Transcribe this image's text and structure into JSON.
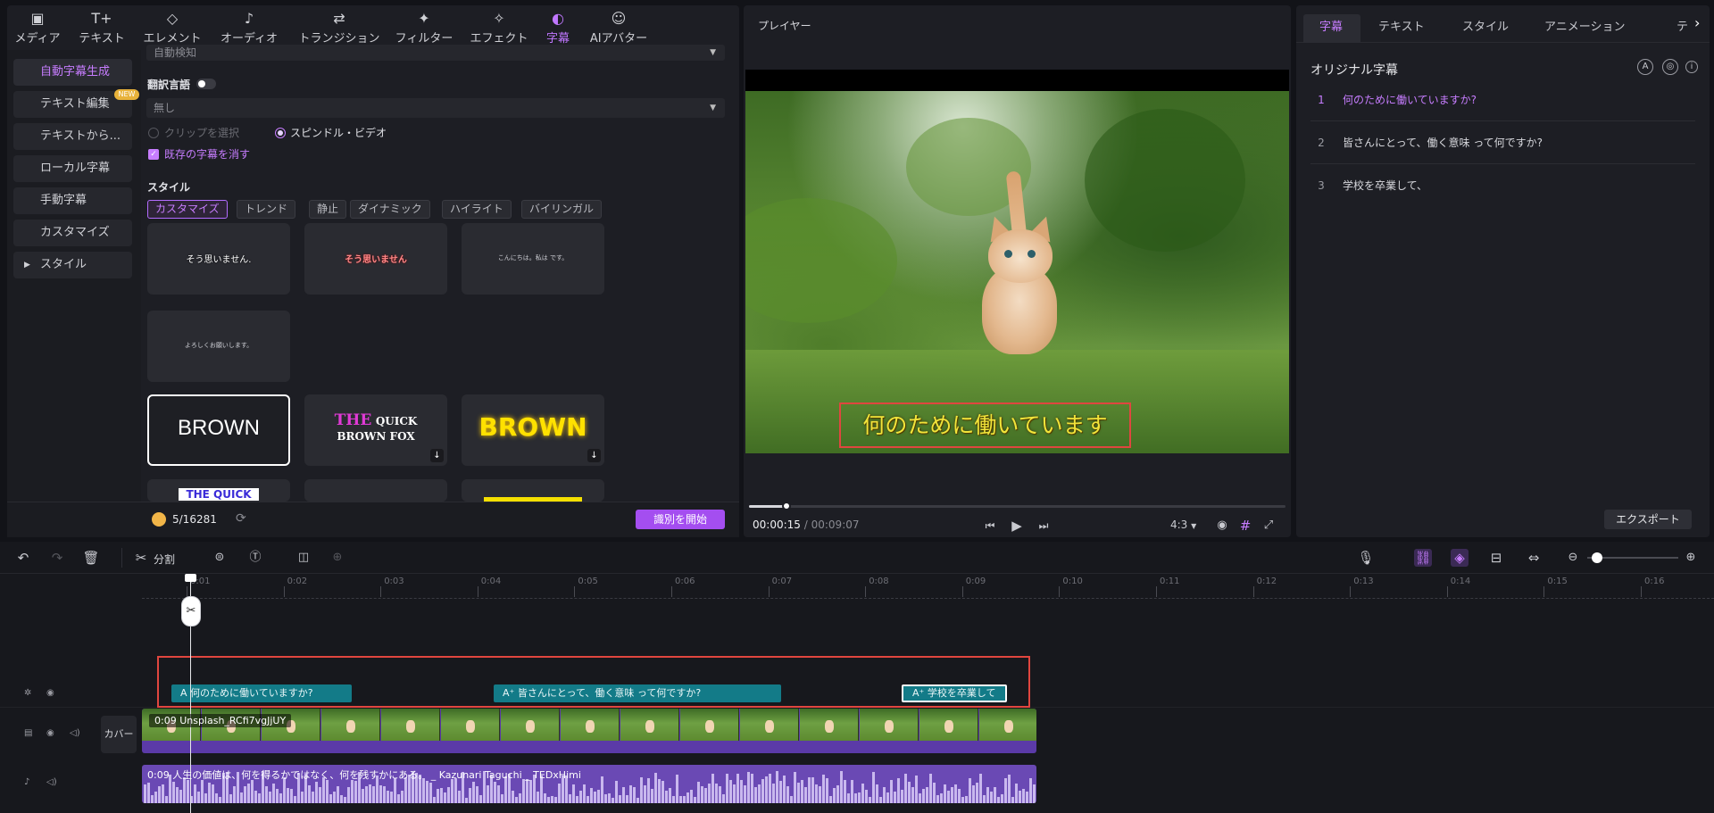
{
  "toolbar": {
    "items": [
      {
        "label": "メディア",
        "icon": "media-icon"
      },
      {
        "label": "テキスト",
        "icon": "text-icon"
      },
      {
        "label": "エレメント",
        "icon": "element-icon"
      },
      {
        "label": "オーディオ",
        "icon": "audio-icon"
      },
      {
        "label": "トランジション",
        "icon": "transition-icon"
      },
      {
        "label": "フィルター",
        "icon": "filter-icon"
      },
      {
        "label": "エフェクト",
        "icon": "effect-icon"
      },
      {
        "label": "字幕",
        "icon": "subtitle-icon"
      },
      {
        "label": "AIアバター",
        "icon": "ai-avatar-icon"
      }
    ],
    "active": "字幕"
  },
  "subtitle_menu": {
    "items": [
      "自動字幕生成",
      "テキスト編集",
      "テキストから...",
      "ローカル字幕",
      "手動字幕",
      "カスタマイズ",
      "スタイル"
    ],
    "new_badge": "NEW"
  },
  "auto_caption": {
    "lang_detect": "自動検知",
    "translate_label": "翻訳言語",
    "translate_value": "無し",
    "option_clip": "クリップを選択",
    "option_video": "スピンドル・ビデオ",
    "remove_existing": "既存の字幕を消す",
    "style_heading": "スタイル",
    "style_tabs": [
      "カスタマイズ",
      "トレンド",
      "静止",
      "ダイナミック",
      "ハイライト",
      "バイリンガル"
    ],
    "tiles_row1": [
      "そう思いません.",
      "そう思いません",
      "こんにちは。私は です。"
    ],
    "tile_row2": "よろしくお願いします。",
    "tile_brown": "BROWN",
    "tile_fox_a": "THE",
    "tile_fox_b": "QUICK",
    "tile_fox_c": "BROWN FOX",
    "tile_brown_yellow": "BROWN",
    "tile_partial": "THE QUICK",
    "credits": "5/16281",
    "start_button": "識別を開始"
  },
  "player": {
    "title": "プレイヤー",
    "current_time": "00:00:15",
    "separator": "/",
    "total_time": "00:09:07",
    "aspect": "4:3",
    "subtitle_overlay": "何のために働いていますか？",
    "progress": 0.07
  },
  "right_panel": {
    "tabs": [
      "字幕",
      "テキスト",
      "スタイル",
      "アニメーション",
      "テキス"
    ],
    "heading": "オリジナル字幕",
    "captions": [
      {
        "num": "1",
        "text": "何のために働いていますか?"
      },
      {
        "num": "2",
        "text": "皆さんにとって、働く意味 って何ですか?"
      },
      {
        "num": "3",
        "text": "学校を卒業して、"
      }
    ],
    "export_button": "エクスポート"
  },
  "timeline": {
    "split_label": "分割",
    "ticks": [
      "0:01",
      "0:02",
      "0:03",
      "0:04",
      "0:05",
      "0:06",
      "0:07",
      "0:08",
      "0:09",
      "0:10",
      "0:11",
      "0:12",
      "0:13",
      "0:14",
      "0:15",
      "0:16"
    ],
    "subtitle_clips": [
      "何のために働いていますか?",
      "皆さんにとって、働く意味 って何ですか?",
      "学校を卒業して"
    ],
    "cover_label": "カバー",
    "video_clip_label": "0:09 Unsplash_RCfi7vgJjUY",
    "audio_clip_label": "0:09 人生の価値は、何を得るかではなく、何を残すかにある。 _ Kazunari Taguchi _ TEDxHimi"
  },
  "colors": {
    "accent": "#c77dff",
    "start_button": "#a44ef0",
    "subtitle_clip": "#137b88",
    "highlight_box": "#e0463f"
  }
}
